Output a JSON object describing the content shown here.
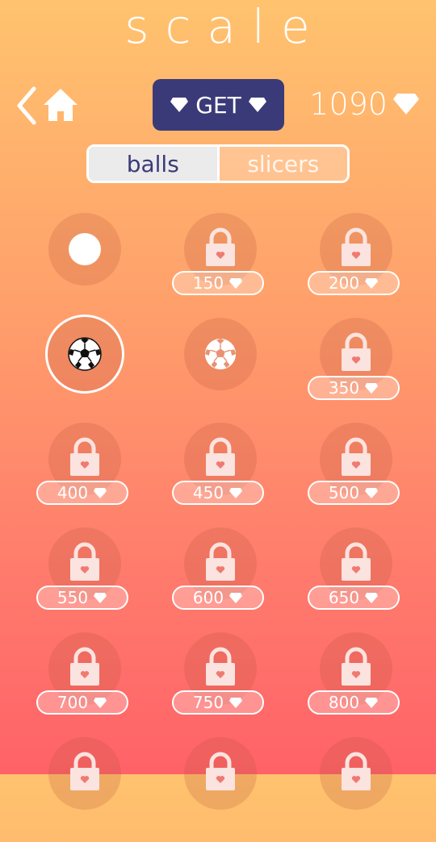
{
  "app": {
    "title": "scale"
  },
  "header": {
    "get_label": "GET",
    "gem_count": "1090"
  },
  "tabs": [
    {
      "label": "balls",
      "active": true
    },
    {
      "label": "slicers",
      "active": false
    }
  ],
  "items": [
    {
      "kind": "white-ball",
      "locked": false
    },
    {
      "kind": "locked",
      "locked": true,
      "price": "150"
    },
    {
      "kind": "locked",
      "locked": true,
      "price": "200"
    },
    {
      "kind": "soccer-ball",
      "locked": false,
      "selected": true
    },
    {
      "kind": "white-soccer-ball",
      "locked": false
    },
    {
      "kind": "locked",
      "locked": true,
      "price": "350"
    },
    {
      "kind": "locked",
      "locked": true,
      "price": "400"
    },
    {
      "kind": "locked",
      "locked": true,
      "price": "450"
    },
    {
      "kind": "locked",
      "locked": true,
      "price": "500"
    },
    {
      "kind": "locked",
      "locked": true,
      "price": "550"
    },
    {
      "kind": "locked",
      "locked": true,
      "price": "600"
    },
    {
      "kind": "locked",
      "locked": true,
      "price": "650"
    },
    {
      "kind": "locked",
      "locked": true,
      "price": "700"
    },
    {
      "kind": "locked",
      "locked": true,
      "price": "750"
    },
    {
      "kind": "locked",
      "locked": true,
      "price": "800"
    },
    {
      "kind": "locked",
      "locked": true
    },
    {
      "kind": "locked",
      "locked": true
    },
    {
      "kind": "locked",
      "locked": true
    }
  ],
  "colors": {
    "accent": "#3b3a78",
    "bg_top": "#ffc36e",
    "bg_bottom": "#ff6268"
  }
}
